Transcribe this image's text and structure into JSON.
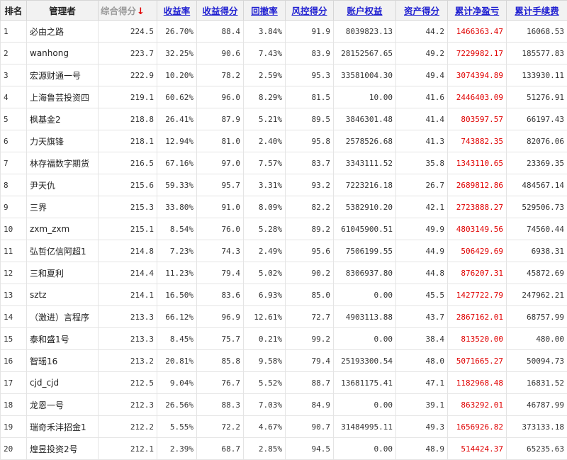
{
  "headers": [
    {
      "label": "排名",
      "style": "plain",
      "name": "header-rank"
    },
    {
      "label": "管理者",
      "style": "plain",
      "name": "header-manager"
    },
    {
      "label": "综合得分",
      "style": "sorted",
      "name": "header-composite-score"
    },
    {
      "label": "收益率",
      "style": "link",
      "name": "header-return-rate"
    },
    {
      "label": "收益得分",
      "style": "link",
      "name": "header-return-score"
    },
    {
      "label": "回撤率",
      "style": "link",
      "name": "header-drawdown-rate"
    },
    {
      "label": "风控得分",
      "style": "link",
      "name": "header-risk-score"
    },
    {
      "label": "账户权益",
      "style": "link",
      "name": "header-account-equity"
    },
    {
      "label": "资产得分",
      "style": "link",
      "name": "header-asset-score"
    },
    {
      "label": "累计净盈亏",
      "style": "link",
      "name": "header-cumulative-pnl"
    },
    {
      "label": "累计手续费",
      "style": "link",
      "name": "header-cumulative-fees"
    }
  ],
  "sort_indicator": "↓",
  "colors": {
    "pnl": "#e00000",
    "link": "#1f1fd1",
    "sorted_header": "#9a9a9a"
  },
  "rows": [
    [
      "1",
      "必由之路",
      "224.5",
      "26.70%",
      "88.4",
      "3.84%",
      "91.9",
      "8039823.13",
      "44.2",
      "1466363.47",
      "16068.53"
    ],
    [
      "2",
      "wanhong",
      "223.7",
      "32.25%",
      "90.6",
      "7.43%",
      "83.9",
      "28152567.65",
      "49.2",
      "7229982.17",
      "185577.83"
    ],
    [
      "3",
      "宏源财通一号",
      "222.9",
      "10.20%",
      "78.2",
      "2.59%",
      "95.3",
      "33581004.30",
      "49.4",
      "3074394.89",
      "133930.11"
    ],
    [
      "4",
      "上海鲁芸投资四",
      "219.1",
      "60.62%",
      "96.0",
      "8.29%",
      "81.5",
      "10.00",
      "41.6",
      "2446403.09",
      "51276.91"
    ],
    [
      "5",
      "枫基金2",
      "218.8",
      "26.41%",
      "87.9",
      "5.21%",
      "89.5",
      "3846301.48",
      "41.4",
      "803597.57",
      "66197.43"
    ],
    [
      "6",
      "力天旗锋",
      "218.1",
      "12.94%",
      "81.0",
      "2.40%",
      "95.8",
      "2578526.68",
      "41.3",
      "743882.35",
      "82076.06"
    ],
    [
      "7",
      "林存福数字期货",
      "216.5",
      "67.16%",
      "97.0",
      "7.57%",
      "83.7",
      "3343111.52",
      "35.8",
      "1343110.65",
      "23369.35"
    ],
    [
      "8",
      "尹天仇",
      "215.6",
      "59.33%",
      "95.7",
      "3.31%",
      "93.2",
      "7223216.18",
      "26.7",
      "2689812.86",
      "484567.14"
    ],
    [
      "9",
      "三界",
      "215.3",
      "33.80%",
      "91.0",
      "8.09%",
      "82.2",
      "5382910.20",
      "42.1",
      "2723888.27",
      "529506.73"
    ],
    [
      "10",
      "zxm_zxm",
      "215.1",
      "8.54%",
      "76.0",
      "5.28%",
      "89.2",
      "61045900.51",
      "49.9",
      "4803149.56",
      "74560.44"
    ],
    [
      "11",
      "弘哲亿信阿超1",
      "214.8",
      "7.23%",
      "74.3",
      "2.49%",
      "95.6",
      "7506199.55",
      "44.9",
      "506429.69",
      "6938.31"
    ],
    [
      "12",
      "三和夏利",
      "214.4",
      "11.23%",
      "79.4",
      "5.02%",
      "90.2",
      "8306937.80",
      "44.8",
      "876207.31",
      "45872.69"
    ],
    [
      "13",
      "sztz",
      "214.1",
      "16.50%",
      "83.6",
      "6.93%",
      "85.0",
      "0.00",
      "45.5",
      "1427722.79",
      "247962.21"
    ],
    [
      "14",
      "（激进）言程序",
      "213.3",
      "66.12%",
      "96.9",
      "12.61%",
      "72.7",
      "4903113.88",
      "43.7",
      "2867162.01",
      "68757.99"
    ],
    [
      "15",
      "泰和盛1号",
      "213.3",
      "8.45%",
      "75.7",
      "0.21%",
      "99.2",
      "0.00",
      "38.4",
      "813520.00",
      "480.00"
    ],
    [
      "16",
      "智瑶16",
      "213.2",
      "20.81%",
      "85.8",
      "9.58%",
      "79.4",
      "25193300.54",
      "48.0",
      "5071665.27",
      "50094.73"
    ],
    [
      "17",
      "cjd_cjd",
      "212.5",
      "9.04%",
      "76.7",
      "5.52%",
      "88.7",
      "13681175.41",
      "47.1",
      "1182968.48",
      "16831.52"
    ],
    [
      "18",
      "龙恩一号",
      "212.3",
      "26.56%",
      "88.3",
      "7.03%",
      "84.9",
      "0.00",
      "39.1",
      "863292.01",
      "46787.99"
    ],
    [
      "19",
      "瑞奇禾沣招金1",
      "212.2",
      "5.55%",
      "72.2",
      "4.67%",
      "90.7",
      "31484995.11",
      "49.3",
      "1656926.82",
      "373133.18"
    ],
    [
      "20",
      "煌昱投资2号",
      "212.1",
      "2.39%",
      "68.7",
      "2.85%",
      "94.5",
      "0.00",
      "48.9",
      "514424.37",
      "65235.63"
    ]
  ]
}
